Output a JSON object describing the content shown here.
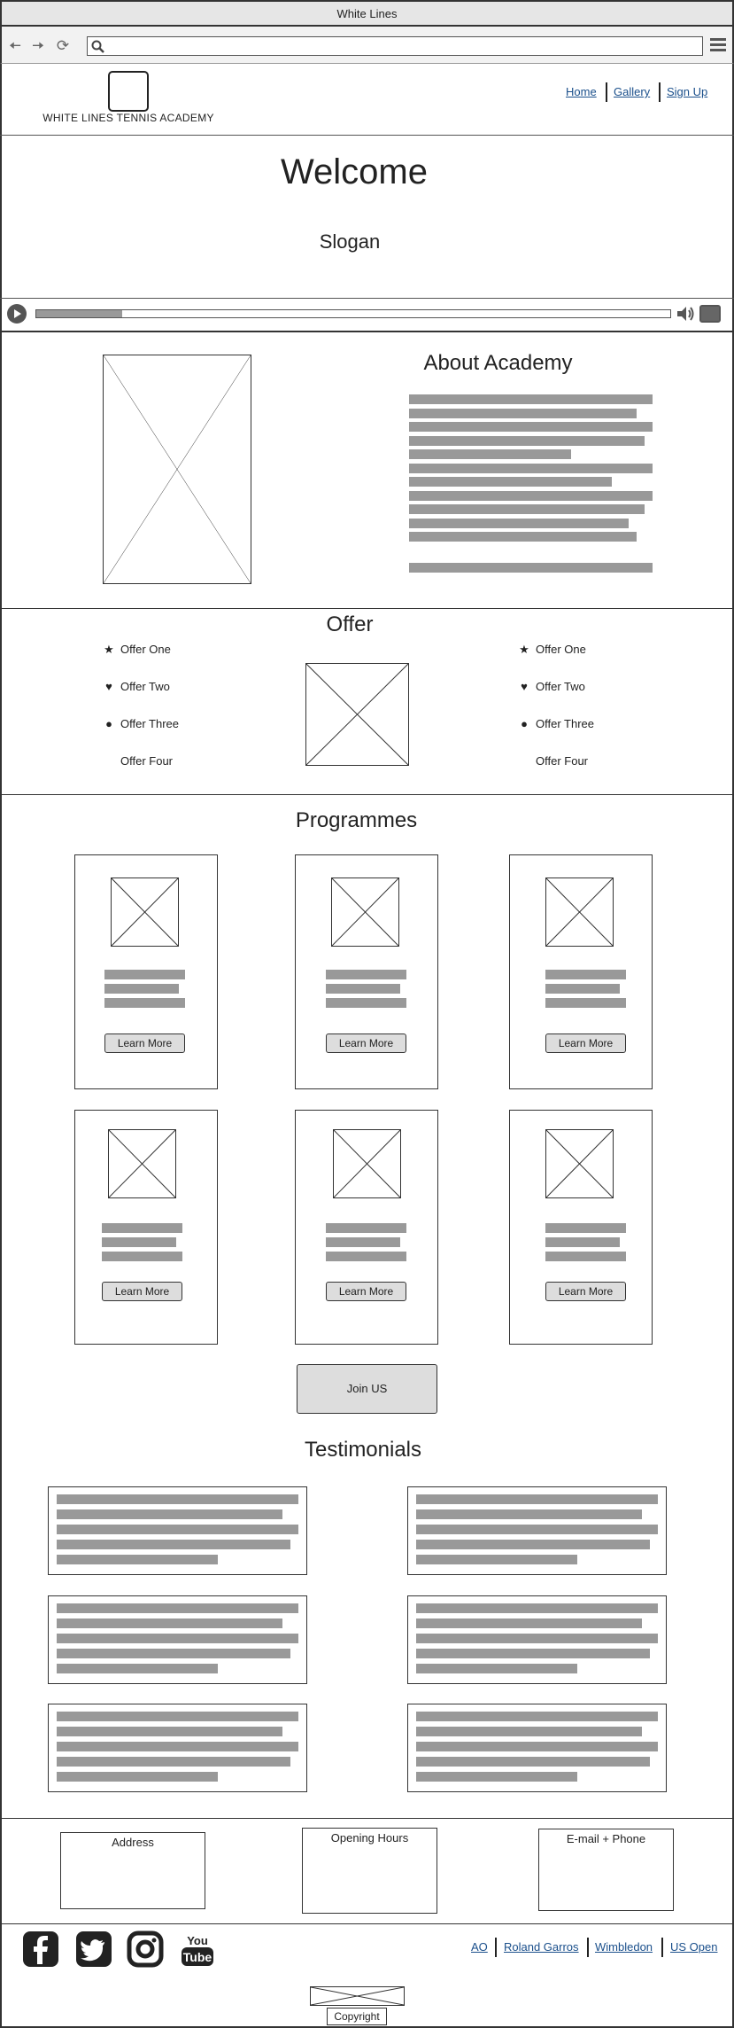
{
  "browser": {
    "title": "White Lines",
    "url": ""
  },
  "header": {
    "brand": "WHITE LINES TENNIS ACADEMY",
    "nav": [
      "Home",
      "Gallery",
      "Sign Up"
    ]
  },
  "hero": {
    "title": "Welcome",
    "slogan": "Slogan",
    "video_progress": 0.135
  },
  "about": {
    "title": "About Academy"
  },
  "offer": {
    "title": "Offer",
    "left": [
      {
        "icon": "star-icon",
        "label": "Offer One"
      },
      {
        "icon": "heart-icon",
        "label": "Offer Two"
      },
      {
        "icon": "circle-icon",
        "label": "Offer Three"
      },
      {
        "icon": "",
        "label": "Offer Four"
      }
    ],
    "right": [
      {
        "icon": "star-icon",
        "label": "Offer One"
      },
      {
        "icon": "heart-icon",
        "label": "Offer Two"
      },
      {
        "icon": "circle-icon",
        "label": "Offer Three"
      },
      {
        "icon": "",
        "label": "Offer Four"
      }
    ]
  },
  "programmes": {
    "title": "Programmes",
    "button_label": "Learn More",
    "cards": [
      1,
      2,
      3,
      4,
      5,
      6
    ],
    "join_label": "Join US"
  },
  "testimonials": {
    "title": "Testimonials"
  },
  "footer": {
    "boxes": [
      "Address",
      "Opening Hours",
      "E-mail + Phone"
    ],
    "social": [
      "facebook-icon",
      "twitter-icon",
      "instagram-icon",
      "youtube-icon"
    ],
    "links": [
      "AO",
      "Roland Garros",
      "Wimbledon",
      "US Open"
    ],
    "copyright": "Copyright"
  },
  "colors": {
    "link": "#1a4f8b",
    "text_placeholder": "#999999",
    "button": "#dddddd"
  }
}
